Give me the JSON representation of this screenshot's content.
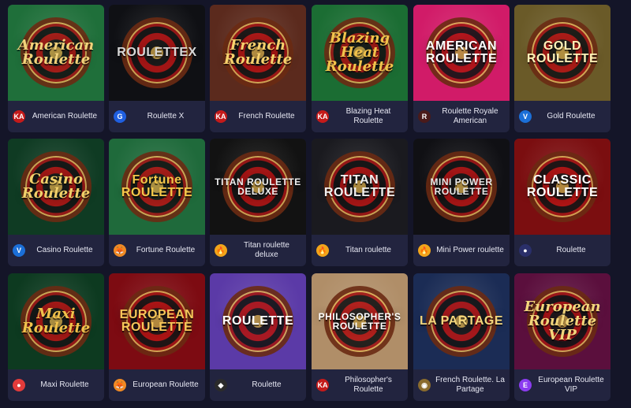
{
  "games": [
    {
      "name": "American Roulette",
      "thumb_title": "American Roulette",
      "bg": "#1f6f3a",
      "provider": "ka",
      "title_color": "#f2d27a",
      "style": "script"
    },
    {
      "name": "Roulette X",
      "thumb_title": "ROULETTEX",
      "bg": "#0f1014",
      "provider": "g",
      "title_color": "#d9d9d9",
      "style": "caps"
    },
    {
      "name": "French Roulette",
      "thumb_title": "French Roulette",
      "bg": "#5b2a1d",
      "provider": "ka",
      "title_color": "#f7d16d",
      "style": "script"
    },
    {
      "name": "Blazing Heat Roulette",
      "thumb_title": "Blazing Heat Roulette",
      "bg": "#1b6d33",
      "provider": "ka",
      "title_color": "#f1c24b",
      "style": "script"
    },
    {
      "name": "Roulette Royale American",
      "thumb_title": "AMERICAN ROULETTE",
      "bg": "#d11b68",
      "provider": "rr",
      "title_color": "#ffffff",
      "style": "caps"
    },
    {
      "name": "Gold Roulette",
      "thumb_title": "GOLD ROULETTE",
      "bg": "#6a5a28",
      "provider": "v",
      "title_color": "#fff2b8",
      "style": "caps"
    },
    {
      "name": "Casino Roulette",
      "thumb_title": "Casino Roulette",
      "bg": "#0f3b23",
      "provider": "v",
      "title_color": "#f1d06a",
      "style": "script"
    },
    {
      "name": "Fortune Roulette",
      "thumb_title": "Fortune ROULETTE",
      "bg": "#1f6a3b",
      "provider": "fox",
      "title_color": "#f5c84a",
      "style": "caps"
    },
    {
      "name": "Titan roulette deluxe",
      "thumb_title": "TITAN ROULETTE DELUXE",
      "bg": "#121212",
      "provider": "flame",
      "title_color": "#f0f0f0",
      "style": "caps"
    },
    {
      "name": "Titan roulette",
      "thumb_title": "TITAN ROULETTE",
      "bg": "#1a1a1f",
      "provider": "flame",
      "title_color": "#f0f0f0",
      "style": "caps"
    },
    {
      "name": "Mini Power roulette",
      "thumb_title": "MINI POWER ROULETTE",
      "bg": "#101014",
      "provider": "flame",
      "title_color": "#e9e9e9",
      "style": "caps"
    },
    {
      "name": "Roulette",
      "thumb_title": "CLASSIC ROULETTE",
      "bg": "#7b0e10",
      "provider": "blue",
      "title_color": "#ffffff",
      "style": "caps"
    },
    {
      "name": "Maxi Roulette",
      "thumb_title": "Maxi Roulette",
      "bg": "#0d3a20",
      "provider": "red",
      "title_color": "#f1c24b",
      "style": "script"
    },
    {
      "name": "European Roulette",
      "thumb_title": "EUROPEAN ROULETTE",
      "bg": "#7d0b12",
      "provider": "fox",
      "title_color": "#f6c75a",
      "style": "caps"
    },
    {
      "name": "Roulette",
      "thumb_title": "ROULETTE",
      "bg": "#5b3aa7",
      "provider": "dark",
      "title_color": "#ffffff",
      "style": "caps"
    },
    {
      "name": "Philosopher's Roulette",
      "thumb_title": "PHILOSOPHER'S ROULETTE",
      "bg": "#b08e68",
      "provider": "ka",
      "title_color": "#ffffff",
      "style": "caps"
    },
    {
      "name": "French Roulette. La Partage",
      "thumb_title": "LA PARTAGE",
      "bg": "#1b2c55",
      "provider": "coin",
      "title_color": "#f3d67c",
      "style": "caps"
    },
    {
      "name": "European Roulette VIP",
      "thumb_title": "European Roulette VIP",
      "bg": "#5b0f3d",
      "provider": "e",
      "title_color": "#f3d67c",
      "style": "script"
    }
  ],
  "provider_icons": {
    "ka": "KA",
    "g": "G",
    "rr": "R",
    "v": "V",
    "fox": "🦊",
    "flame": "🔥",
    "blue": "●",
    "red": "●",
    "dark": "◆",
    "coin": "◉",
    "e": "E"
  },
  "provider_colors": {
    "ka": "#c41a1a",
    "g": "#1f5fe0",
    "rr": "#4a1a1a",
    "v": "#1b6fd8",
    "fox": "#f08a24",
    "flame": "#f2a51a",
    "blue": "#2a2f6a",
    "red": "#e23b3b",
    "dark": "#2b2b2b",
    "coin": "#8a6b2d",
    "e": "#8b3cf0"
  }
}
